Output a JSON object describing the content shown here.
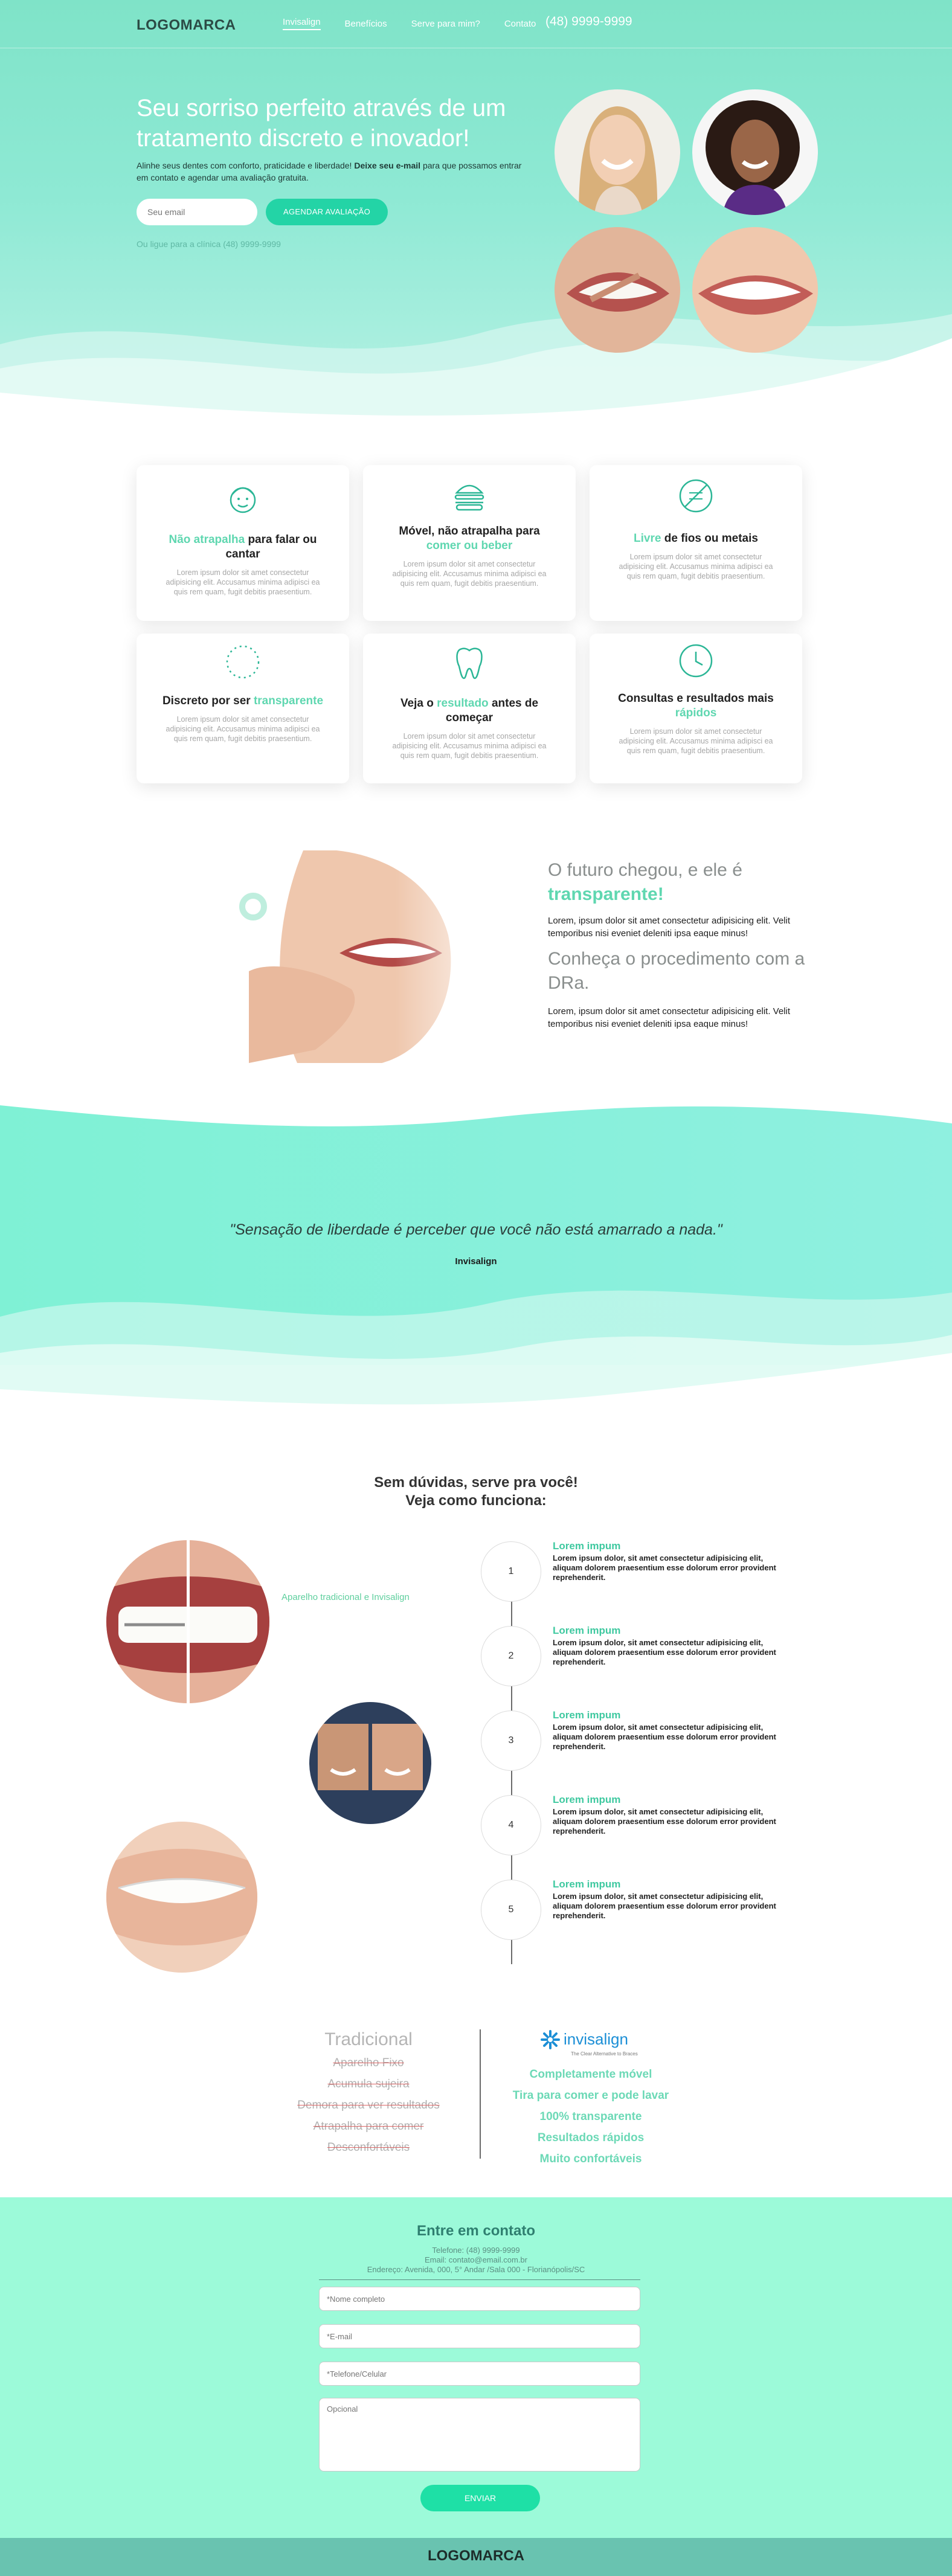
{
  "nav": {
    "logo": "LOGOMARCA",
    "links": [
      "Invisalign",
      "Benefícios",
      "Serve para mim?",
      "Contato"
    ],
    "phone": "(48) 9999-9999"
  },
  "hero": {
    "title": "Seu sorriso perfeito através de um tratamento discreto e inovador!",
    "subtitle_start": "Alinhe seus dentes com conforto, praticidade e liberdade!",
    "subtitle_bold": "Deixe seu e-mail",
    "subtitle_end": "para que possamos entrar em contato e agendar uma avaliação gratuita.",
    "email_placeholder": "Seu email",
    "cta_label": "AGENDAR AVALIAÇÃO",
    "phone_note": "Ou ligue para a clínica (48) 9999-9999"
  },
  "features": [
    {
      "icon": "face-icon",
      "title_hl": "Não atrapalha",
      "title": "para falar ou cantar",
      "text": "Lorem ipsum dolor sit amet consectetur adipisicing elit. Accusamus minima adipisci ea quis rem quam, fugit debitis praesentium."
    },
    {
      "icon": "burger-icon",
      "title": "Móvel, não atrapalha para",
      "title_hl": "comer ou beber",
      "text": "Lorem ipsum dolor sit amet consectetur adipisicing elit. Accusamus minima adipisci ea quis rem quam, fugit debitis praesentium."
    },
    {
      "icon": "no-wires-icon",
      "title_hl": "Livre",
      "title": "de fios ou metais",
      "text": "Lorem ipsum dolor sit amet consectetur adipisicing elit. Accusamus minima adipisci ea quis rem quam, fugit debitis praesentium."
    },
    {
      "icon": "dotted-circle-icon",
      "title": "Discreto por ser",
      "title_hl": "transparente",
      "text": "Lorem ipsum dolor sit amet consectetur adipisicing elit. Accusamus minima adipisci ea quis rem quam, fugit debitis praesentium."
    },
    {
      "icon": "tooth-icon",
      "title_a": "Veja o",
      "title_hl": "resultado",
      "title_b": "antes de começar",
      "text": "Lorem ipsum dolor sit amet consectetur adipisicing elit. Accusamus minima adipisci ea quis rem quam, fugit debitis praesentium."
    },
    {
      "icon": "clock-icon",
      "title": "Consultas e resultados mais",
      "title_hl": "rápidos",
      "text": "Lorem ipsum dolor sit amet consectetur adipisicing elit. Accusamus minima adipisci ea quis rem quam, fugit debitis praesentium."
    }
  ],
  "about": {
    "heading1_start": "O futuro chegou, e ele é",
    "heading1_hl": "transparente!",
    "text1": "Lorem, ipsum dolor sit amet consectetur adipisicing elit. Velit temporibus nisi eveniet deleniti ipsa eaque minus!",
    "heading2": "Conheça o procedimento com a DRa.",
    "text2": "Lorem, ipsum dolor sit amet consectetur adipisicing elit. Velit temporibus nisi eveniet deleniti ipsa eaque minus!"
  },
  "quote": {
    "text": "\"Sensação de liberdade é perceber que você não está amarrado a nada.\"",
    "author": "Invisalign"
  },
  "how": {
    "title_line1": "Sem dúvidas, serve pra você!",
    "title_line2": "Veja como funciona:",
    "caption": "Aparelho tradicional e Invisalign",
    "steps": [
      {
        "num": "1",
        "title": "Lorem impum",
        "text": "Lorem ipsum dolor, sit amet consectetur adipisicing elit, aliquam dolorem praesentium esse dolorum error provident reprehenderit."
      },
      {
        "num": "2",
        "title": "Lorem impum",
        "text": "Lorem ipsum dolor, sit amet consectetur adipisicing elit, aliquam dolorem praesentium esse dolorum error provident reprehenderit."
      },
      {
        "num": "3",
        "title": "Lorem impum",
        "text": "Lorem ipsum dolor, sit amet consectetur adipisicing elit, aliquam dolorem praesentium esse dolorum error provident reprehenderit."
      },
      {
        "num": "4",
        "title": "Lorem impum",
        "text": "Lorem ipsum dolor, sit amet consectetur adipisicing elit, aliquam dolorem praesentium esse dolorum error provident reprehenderit."
      },
      {
        "num": "5",
        "title": "Lorem impum",
        "text": "Lorem ipsum dolor, sit amet consectetur adipisicing elit, aliquam dolorem praesentium esse dolorum error provident reprehenderit."
      }
    ]
  },
  "compare": {
    "traditional_title": "Tradicional",
    "traditional_items": [
      "Aparelho Fixo",
      "Acumula sujeira",
      "Demora para ver resultados",
      "Atrapalha para comer",
      "Desconfortáveis"
    ],
    "invisalign_logo": "invisalign",
    "invisalign_tagline": "The Clear Alternative to Braces",
    "invisalign_items": [
      "Completamente móvel",
      "Tira para comer e pode lavar",
      "100% transparente",
      "Resultados rápidos",
      "Muito confortáveis"
    ]
  },
  "contact": {
    "title": "Entre em contato",
    "phone": "Telefone: (48) 9999-9999",
    "email": "Email: contato@email.com.br",
    "address": "Endereço: Avenida, 000, 5° Andar /Sala 000 - Florianópolis/SC",
    "name_placeholder": "*Nome completo",
    "email_placeholder": "*E-mail",
    "phone_placeholder": "*Telefone/Celular",
    "optional_placeholder": "Opcional",
    "send_label": "ENVIAR"
  },
  "footer": {
    "logo": "LOGOMARCA"
  },
  "colors": {
    "accent": "#23d4a6",
    "mint": "#9cfad9",
    "text_dark": "#222222",
    "highlight": "#5fd7b0"
  }
}
